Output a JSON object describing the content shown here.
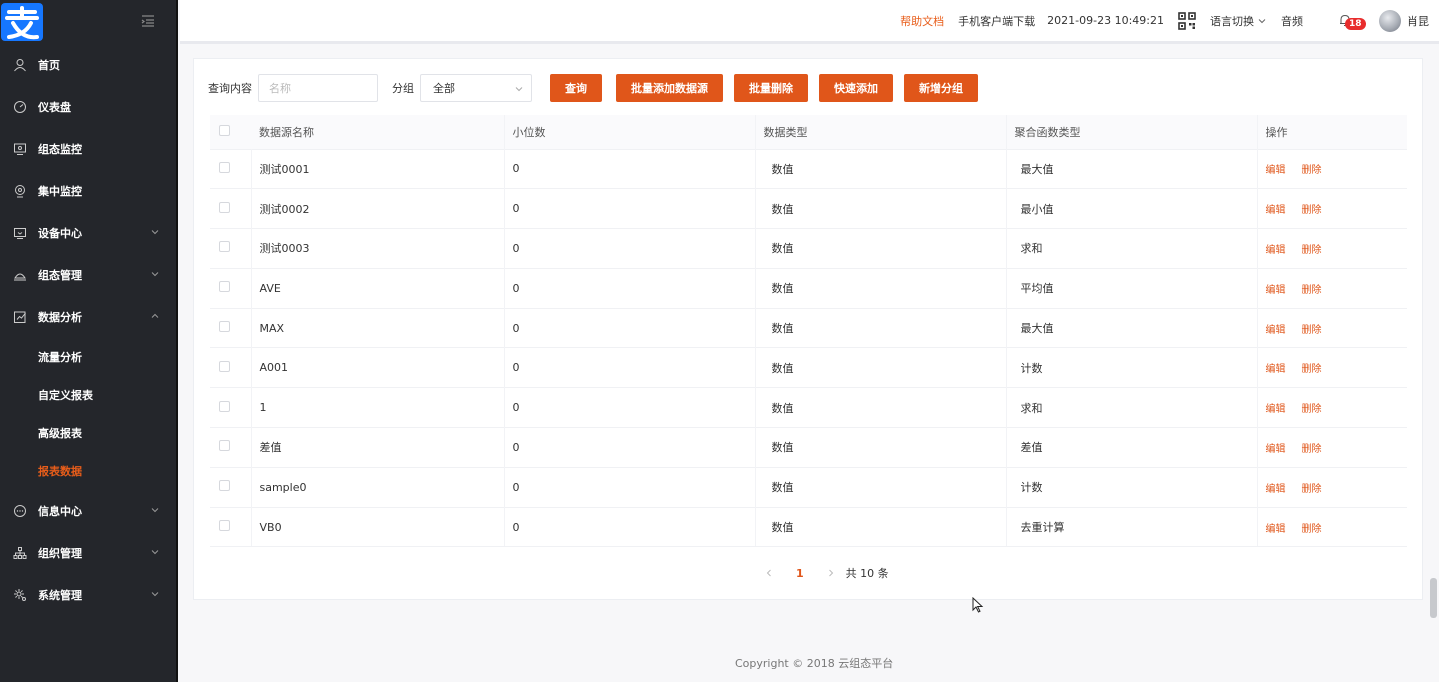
{
  "header": {
    "help": "帮助文档",
    "mobile_download": "手机客户端下载",
    "datetime": "2021-09-23 10:49:21",
    "language": "语言切换",
    "audio": "音频",
    "notification_count": "18",
    "username": "肖昆"
  },
  "sidebar": {
    "items": [
      {
        "label": "首页",
        "icon": "user-icon"
      },
      {
        "label": "仪表盘",
        "icon": "dashboard-icon"
      },
      {
        "label": "组态监控",
        "icon": "monitor-icon"
      },
      {
        "label": "集中监控",
        "icon": "camera-icon"
      },
      {
        "label": "设备中心",
        "icon": "device-icon"
      },
      {
        "label": "组态管理",
        "icon": "config-icon"
      },
      {
        "label": "数据分析",
        "icon": "analysis-icon"
      },
      {
        "label": "信息中心",
        "icon": "message-icon"
      },
      {
        "label": "组织管理",
        "icon": "org-icon"
      },
      {
        "label": "系统管理",
        "icon": "gear-icon"
      }
    ],
    "sub_items": [
      "流量分析",
      "自定义报表",
      "高级报表",
      "报表数据"
    ]
  },
  "toolbar": {
    "query_label": "查询内容",
    "query_placeholder": "名称",
    "group_label": "分组",
    "group_value": "全部",
    "btn_query": "查询",
    "btn_batch_add": "批量添加数据源",
    "btn_batch_delete": "批量删除",
    "btn_quick_add": "快速添加",
    "btn_new_group": "新增分组"
  },
  "table": {
    "columns": [
      "数据源名称",
      "小位数",
      "数据类型",
      "聚合函数类型",
      "操作"
    ],
    "edit_label": "编辑",
    "delete_label": "删除",
    "rows": [
      {
        "name": "测试0001",
        "decimals": "0",
        "type": "数值",
        "agg": "最大值"
      },
      {
        "name": "测试0002",
        "decimals": "0",
        "type": "数值",
        "agg": "最小值"
      },
      {
        "name": "测试0003",
        "decimals": "0",
        "type": "数值",
        "agg": "求和"
      },
      {
        "name": "AVE",
        "decimals": "0",
        "type": "数值",
        "agg": "平均值"
      },
      {
        "name": "MAX",
        "decimals": "0",
        "type": "数值",
        "agg": "最大值"
      },
      {
        "name": "A001",
        "decimals": "0",
        "type": "数值",
        "agg": "计数"
      },
      {
        "name": "1",
        "decimals": "0",
        "type": "数值",
        "agg": "求和"
      },
      {
        "name": "差值",
        "decimals": "0",
        "type": "数值",
        "agg": "差值"
      },
      {
        "name": "sample0",
        "decimals": "0",
        "type": "数值",
        "agg": "计数"
      },
      {
        "name": "VB0",
        "decimals": "0",
        "type": "数值",
        "agg": "去重计算"
      }
    ]
  },
  "pagination": {
    "current_page": "1",
    "total": "共 10 条"
  },
  "footer": "Copyright © 2018 云组态平台",
  "colors": {
    "accent": "#e0561a",
    "sidebar_bg": "#24262b",
    "badge": "#e82d2d"
  }
}
